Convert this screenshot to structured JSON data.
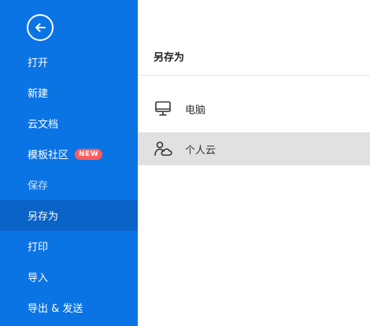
{
  "sidebar": {
    "items": [
      {
        "label": "打开"
      },
      {
        "label": "新建"
      },
      {
        "label": "云文档"
      },
      {
        "label": "模板社区",
        "badge": "NEW"
      },
      {
        "label": "保存"
      },
      {
        "label": "另存为"
      },
      {
        "label": "打印"
      },
      {
        "label": "导入"
      },
      {
        "label": "导出 & 发送"
      }
    ],
    "active_item": "另存为"
  },
  "panel": {
    "title": "另存为",
    "options": [
      {
        "label": "电脑",
        "icon": "monitor-icon"
      },
      {
        "label": "个人云",
        "icon": "user-cloud-icon"
      }
    ],
    "selected_option": "个人云"
  },
  "colors": {
    "sidebar_bg": "#0b74e5",
    "active_item_bg": "#0a63c7",
    "badge_bg": "#ff5b5b",
    "selected_option_bg": "#e1e1e1"
  }
}
